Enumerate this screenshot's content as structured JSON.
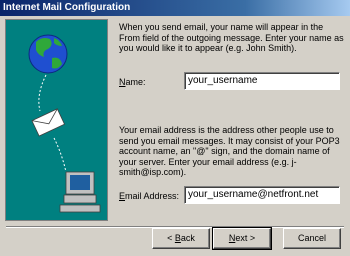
{
  "window": {
    "title": "Internet Mail Configuration"
  },
  "intro_text": "When you send email, your name will appear in the From field of the outgoing message. Enter your name as you would like it to appear (e.g. John Smith).",
  "name_field": {
    "label_prefix": "",
    "label_accel": "N",
    "label_rest": "ame:",
    "value": "your_username"
  },
  "email_text": "Your email address is the address other people use to send you email messages. It may consist of your POP3 account name, an \"@\" sign, and the domain name of your server. Enter your email address (e.g. j-smith@isp.com).",
  "email_field": {
    "label_prefix": "",
    "label_accel": "E",
    "label_rest": "mail Address:",
    "value": "your_username@netfront.net"
  },
  "buttons": {
    "back": {
      "prefix": "< ",
      "accel": "B",
      "rest": "ack"
    },
    "next": {
      "prefix": "",
      "accel": "N",
      "rest": "ext >"
    },
    "cancel": {
      "label": "Cancel"
    }
  },
  "icons": [
    "globe-icon",
    "envelope-icon",
    "computer-icon"
  ]
}
